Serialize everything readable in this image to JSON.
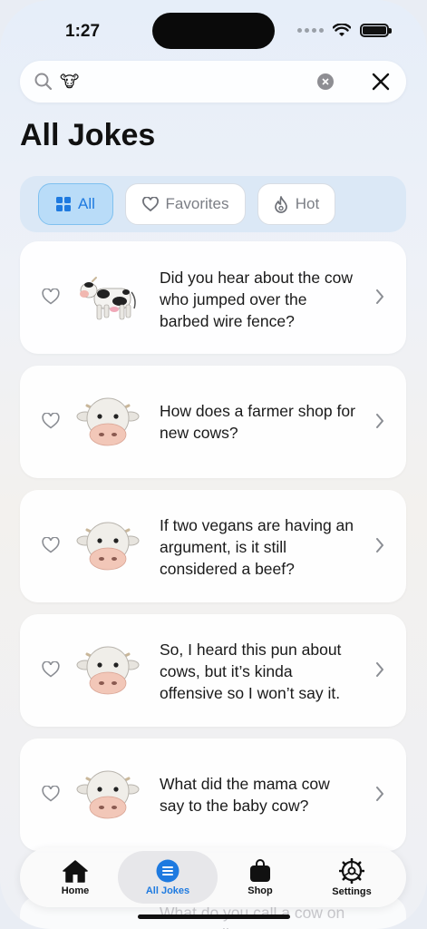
{
  "status": {
    "time": "1:27"
  },
  "search": {
    "value": "🐮",
    "placeholder": ""
  },
  "page": {
    "title": "All Jokes"
  },
  "filters": [
    {
      "label": "All",
      "icon": "grid-icon",
      "active": true
    },
    {
      "label": "Favorites",
      "icon": "heart-icon",
      "active": false
    },
    {
      "label": "Hot",
      "icon": "flame-icon",
      "active": false
    }
  ],
  "jokes": [
    {
      "text": "Did you hear about the cow who jumped over the barbed wire fence?",
      "icon": "cow-icon"
    },
    {
      "text": "How does a farmer shop for new cows?",
      "icon": "cow-face-icon"
    },
    {
      "text": "If two vegans are having an argument, is it still considered a beef?",
      "icon": "cow-face-icon"
    },
    {
      "text": "So, I heard this pun about cows, but it’s kinda offensive so I won’t say it.",
      "icon": "cow-face-icon"
    },
    {
      "text": "What did the mama cow say to the baby cow?",
      "icon": "cow-face-icon"
    },
    {
      "text": "What do you call a cow on a trampoline?",
      "icon": "cow-face-icon"
    }
  ],
  "tabbar": {
    "home": "Home",
    "jokes": "All Jokes",
    "shop": "Shop",
    "settings": "Settings"
  },
  "colors": {
    "accent": "#1e7ae0",
    "filter_tray": "#dbe8f6",
    "active_tab": "#b9dcf8"
  }
}
